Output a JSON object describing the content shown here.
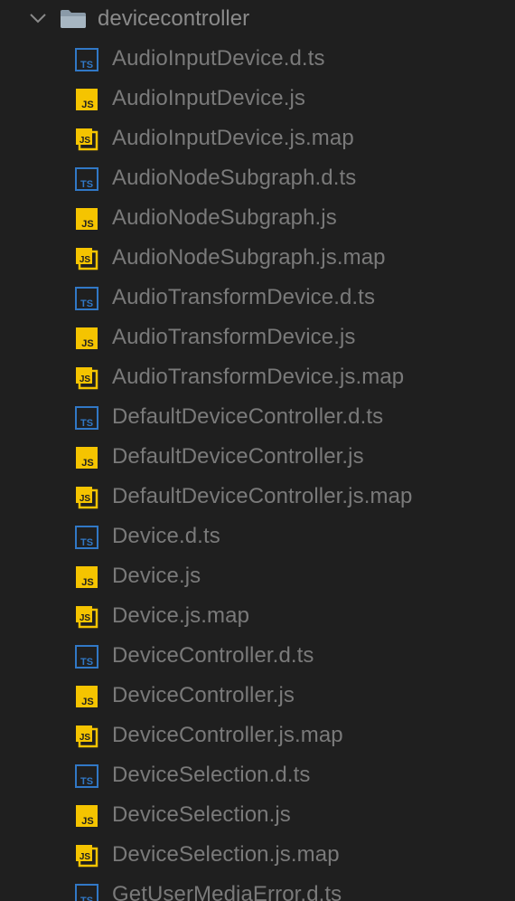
{
  "folder": {
    "name": "devicecontroller",
    "expanded": true,
    "chevron_icon": "chevron-down-icon",
    "icon": "folder-open-icon"
  },
  "colors": {
    "background": "#1f1f1f",
    "text": "#7a7a7a",
    "ts_icon": "#3178c6",
    "js_icon": "#f5c400"
  },
  "files": [
    {
      "name": "AudioInputDevice.d.ts",
      "type": "ts"
    },
    {
      "name": "AudioInputDevice.js",
      "type": "js"
    },
    {
      "name": "AudioInputDevice.js.map",
      "type": "jsmap"
    },
    {
      "name": "AudioNodeSubgraph.d.ts",
      "type": "ts"
    },
    {
      "name": "AudioNodeSubgraph.js",
      "type": "js"
    },
    {
      "name": "AudioNodeSubgraph.js.map",
      "type": "jsmap"
    },
    {
      "name": "AudioTransformDevice.d.ts",
      "type": "ts"
    },
    {
      "name": "AudioTransformDevice.js",
      "type": "js"
    },
    {
      "name": "AudioTransformDevice.js.map",
      "type": "jsmap"
    },
    {
      "name": "DefaultDeviceController.d.ts",
      "type": "ts"
    },
    {
      "name": "DefaultDeviceController.js",
      "type": "js"
    },
    {
      "name": "DefaultDeviceController.js.map",
      "type": "jsmap"
    },
    {
      "name": "Device.d.ts",
      "type": "ts"
    },
    {
      "name": "Device.js",
      "type": "js"
    },
    {
      "name": "Device.js.map",
      "type": "jsmap"
    },
    {
      "name": "DeviceController.d.ts",
      "type": "ts"
    },
    {
      "name": "DeviceController.js",
      "type": "js"
    },
    {
      "name": "DeviceController.js.map",
      "type": "jsmap"
    },
    {
      "name": "DeviceSelection.d.ts",
      "type": "ts"
    },
    {
      "name": "DeviceSelection.js",
      "type": "js"
    },
    {
      "name": "DeviceSelection.js.map",
      "type": "jsmap"
    },
    {
      "name": "GetUserMediaError.d.ts",
      "type": "ts"
    }
  ],
  "icon_text": {
    "ts": "TS",
    "js": "JS"
  }
}
